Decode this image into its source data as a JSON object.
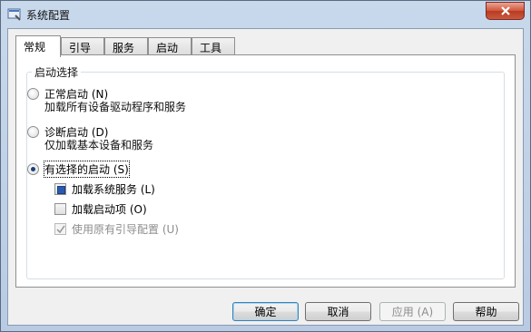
{
  "window": {
    "title": "系统配置"
  },
  "tabs": [
    {
      "label": "常规"
    },
    {
      "label": "引导"
    },
    {
      "label": "服务"
    },
    {
      "label": "启动"
    },
    {
      "label": "工具"
    }
  ],
  "startup": {
    "group_label": "启动选择",
    "options": [
      {
        "label": "正常启动 (N)",
        "description": "加载所有设备驱动程序和服务",
        "selected": false
      },
      {
        "label": "诊断启动 (D)",
        "description": "仅加载基本设备和服务",
        "selected": false
      },
      {
        "label": "有选择的启动 (S)",
        "description": "",
        "selected": true
      }
    ],
    "selective": [
      {
        "label": "加载系统服务 (L)",
        "state": "indeterminate",
        "enabled": true
      },
      {
        "label": "加载启动项 (O)",
        "state": "unchecked",
        "enabled": true
      },
      {
        "label": "使用原有引导配置 (U)",
        "state": "checked",
        "enabled": false
      }
    ]
  },
  "buttons": {
    "ok": "确定",
    "cancel": "取消",
    "apply": "应用 (A)",
    "help": "帮助"
  },
  "colors": {
    "accent": "#1b3f7a",
    "close": "#c84a30",
    "frame": "#b8cbe3"
  }
}
